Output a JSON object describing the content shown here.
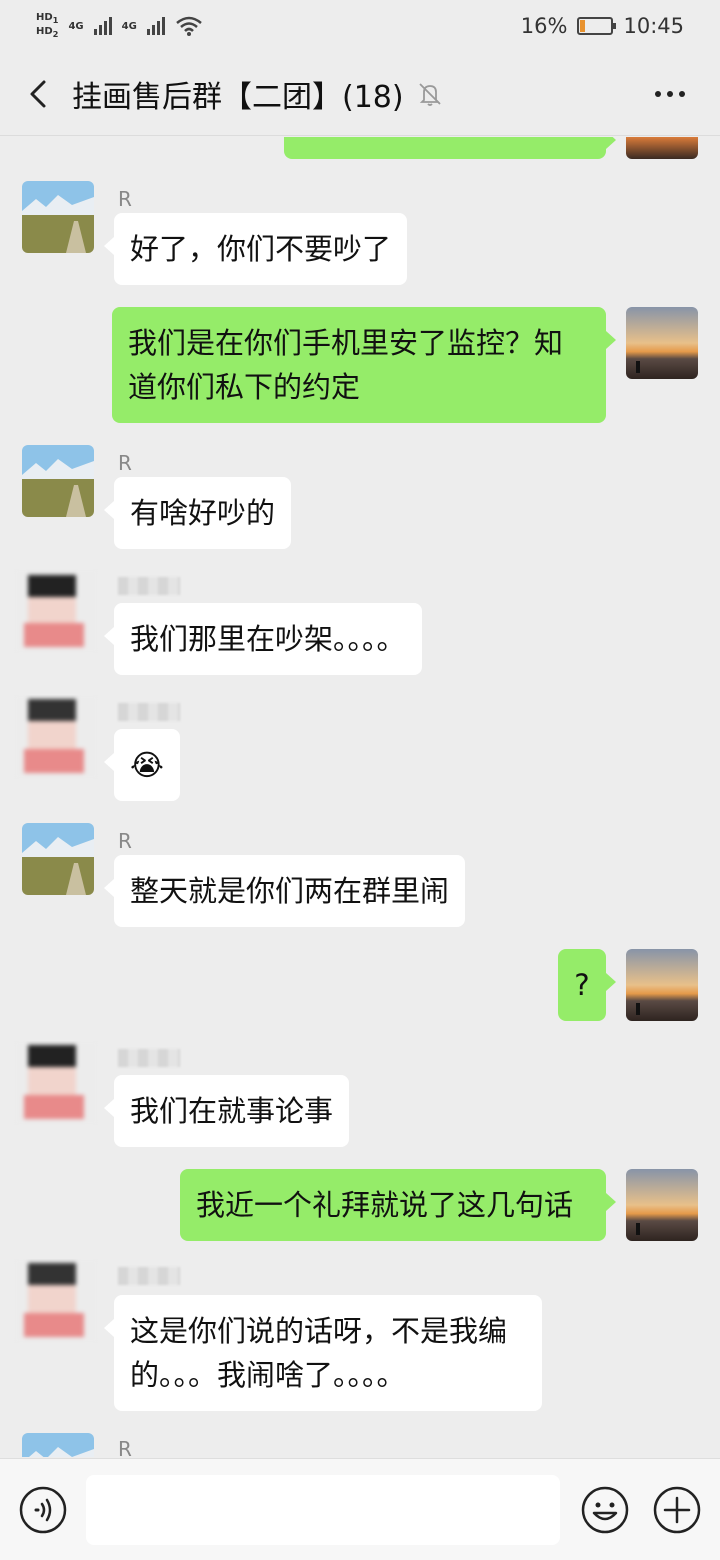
{
  "status_bar": {
    "hd1": "HD",
    "hd1_sub": "1",
    "hd2": "HD",
    "hd2_sub": "2",
    "net1": "4G",
    "net2": "4G",
    "battery_percent": "16%",
    "battery_level": 0.16,
    "time": "10:45"
  },
  "header": {
    "title": "挂画售后群【二团】(18)"
  },
  "chat": {
    "messages": [
      {
        "side": "right",
        "text": ""
      },
      {
        "side": "left",
        "sender": "R",
        "text": "好了，你们不要吵了"
      },
      {
        "side": "right",
        "text": "我们是在你们手机里安了监控？知\n道你们私下的约定"
      },
      {
        "side": "left",
        "sender": "R",
        "text": "有啥好吵的"
      },
      {
        "side": "left",
        "text": "我们那里在吵架。。。。"
      },
      {
        "side": "left",
        "text": "😭"
      },
      {
        "side": "left",
        "sender": "R",
        "text": "整天就是你们两在群里闹"
      },
      {
        "side": "right",
        "text": "?"
      },
      {
        "side": "left",
        "text": "我们在就事论事"
      },
      {
        "side": "right",
        "text": "我近一个礼拜就说了这几句话"
      },
      {
        "side": "left",
        "text": "这是你们说的话呀，不是我编\n的。。。我闹啥了。。。。"
      },
      {
        "side": "left",
        "sender": "R",
        "text": ""
      }
    ]
  },
  "colors": {
    "background": "#ededed",
    "bubble_self": "#95ec69",
    "bubble_other": "#ffffff",
    "battery": "#e8922f"
  },
  "icons": {
    "back": "back-arrow-icon",
    "mute": "mute-bell-icon",
    "more": "more-dots-icon",
    "voice": "voice-icon",
    "emoji": "emoji-icon",
    "plus": "plus-icon"
  },
  "input": {
    "value": ""
  }
}
